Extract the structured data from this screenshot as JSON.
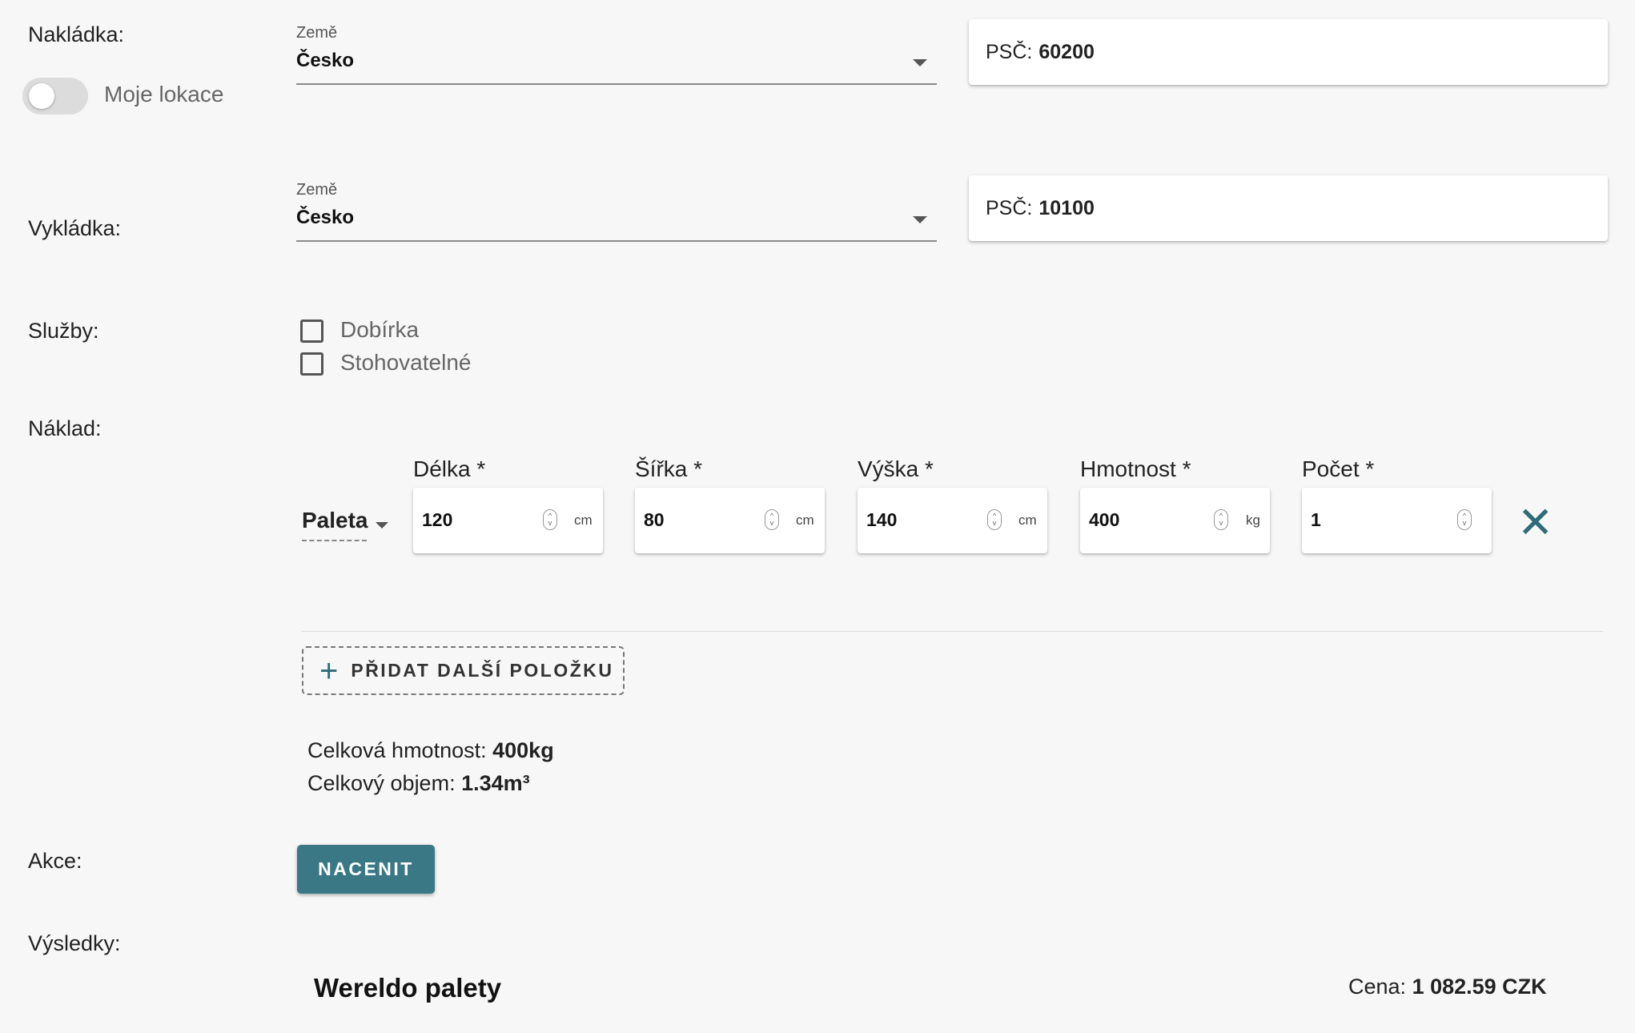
{
  "loading": {
    "label": "Nakládka:",
    "country_label": "Země",
    "country_value": "Česko",
    "psc_label": "PSČ:",
    "psc_value": "60200",
    "my_location_label": "Moje lokace",
    "my_location_on": false
  },
  "unloading": {
    "label": "Vykládka:",
    "country_label": "Země",
    "country_value": "Česko",
    "psc_label": "PSČ:",
    "psc_value": "10100"
  },
  "services": {
    "label": "Služby:",
    "options": [
      {
        "label": "Dobírka",
        "checked": false
      },
      {
        "label": "Stohovatelné",
        "checked": false
      }
    ]
  },
  "cargo": {
    "label": "Náklad:",
    "type_value": "Paleta",
    "fields": [
      {
        "title": "Délka *",
        "value": "120",
        "unit": "cm"
      },
      {
        "title": "Šířka *",
        "value": "80",
        "unit": "cm"
      },
      {
        "title": "Výška *",
        "value": "140",
        "unit": "cm"
      },
      {
        "title": "Hmotnost *",
        "value": "400",
        "unit": "kg"
      },
      {
        "title": "Počet *",
        "value": "1",
        "unit": ""
      }
    ],
    "add_item_label": "PŘIDAT DALŠÍ POLOŽKU",
    "total_weight_label": "Celková hmotnost:",
    "total_weight_value": "400kg",
    "total_volume_label": "Celkový objem:",
    "total_volume_value": "1.34m³"
  },
  "actions": {
    "label": "Akce:",
    "price_button": "NACENIT"
  },
  "results": {
    "label": "Výsledky:",
    "items": [
      {
        "name": "Wereldo palety",
        "price_label": "Cena:",
        "price_value": "1 082.59 CZK"
      }
    ]
  },
  "colors": {
    "accent": "#3a7885",
    "close_icon": "#2f6b78",
    "background": "#f7f7f7"
  }
}
